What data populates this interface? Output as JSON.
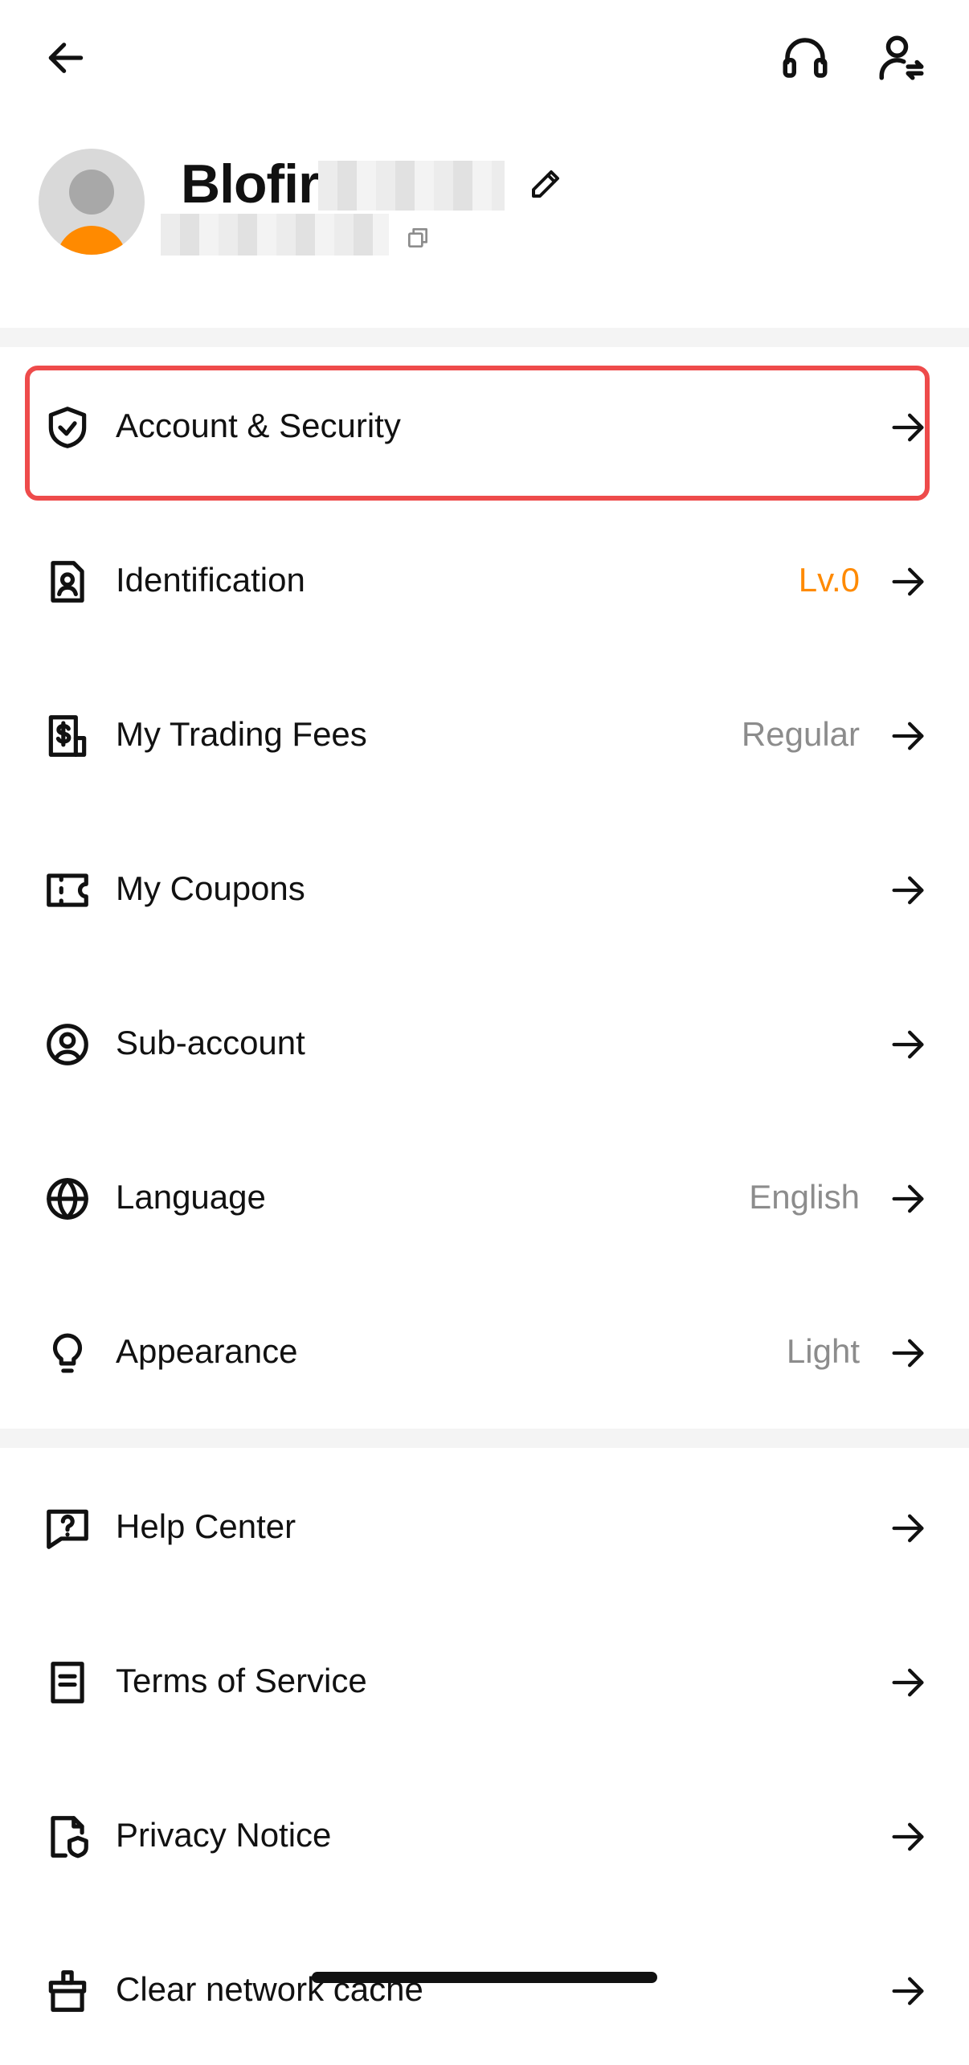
{
  "header": {
    "back_icon": "arrow-left-icon",
    "support_icon": "headset-icon",
    "switch_account_icon": "user-switch-icon"
  },
  "profile": {
    "username_visible": "Blofir",
    "edit_icon": "pencil-icon",
    "copy_icon": "copy-icon"
  },
  "menu_section_1": [
    {
      "label": "Account & Security",
      "value": "",
      "icon": "shield-check-icon"
    },
    {
      "label": "Identification",
      "value": "Lv.0",
      "icon": "id-card-icon"
    },
    {
      "label": "My Trading Fees",
      "value": "Regular",
      "icon": "dollar-receipt-icon"
    },
    {
      "label": "My Coupons",
      "value": "",
      "icon": "ticket-icon"
    },
    {
      "label": "Sub-account",
      "value": "",
      "icon": "user-circle-icon"
    },
    {
      "label": "Language",
      "value": "English",
      "icon": "globe-icon"
    },
    {
      "label": "Appearance",
      "value": "Light",
      "icon": "lightbulb-icon"
    }
  ],
  "menu_section_2": [
    {
      "label": "Help Center",
      "value": "",
      "icon": "help-chat-icon"
    },
    {
      "label": "Terms of Service",
      "value": "",
      "icon": "document-icon"
    },
    {
      "label": "Privacy Notice",
      "value": "",
      "icon": "privacy-document-icon"
    },
    {
      "label": "Clear network cache",
      "value": "",
      "icon": "broom-icon"
    }
  ],
  "colors": {
    "accent": "#ff8a00",
    "highlight_border": "#ee4b4b",
    "secondary_text": "#8c8c8c",
    "divider": "#f4f4f4"
  }
}
